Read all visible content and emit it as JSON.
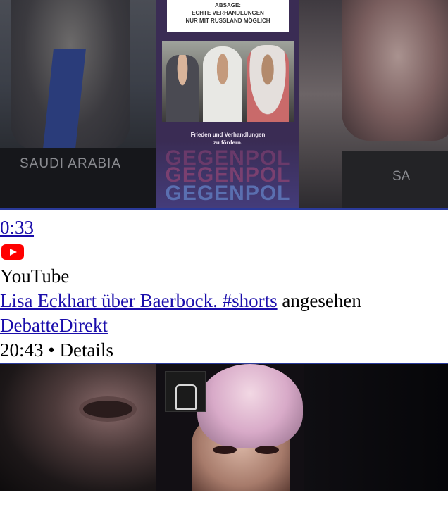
{
  "item1": {
    "thumbnail": {
      "banner_line1": "ABSAGE:",
      "banner_line2": "ECHTE VERHANDLUNGEN",
      "banner_line3": "NUR MIT RUSSLAND MÖGLICH",
      "caption_line1": "Frieden und Verhandlungen",
      "caption_line2": "zu fördern.",
      "watermark": "GEGENPOL",
      "left_plate": "SAUDI ARABIA",
      "right_plate": "SA"
    },
    "duration": "0:33"
  },
  "item2": {
    "source_icon": "youtube-icon",
    "source": "YouTube",
    "title_link": "Lisa Eckhart über Baerbock. #shorts",
    "title_suffix": " angesehen",
    "channel": "DebatteDirekt",
    "time": "20:43",
    "separator": " • ",
    "details_label": "Details"
  },
  "colors": {
    "link": "#1a0dab",
    "youtube_red": "#ff0000",
    "thumb_border": "#2a3a9a"
  }
}
